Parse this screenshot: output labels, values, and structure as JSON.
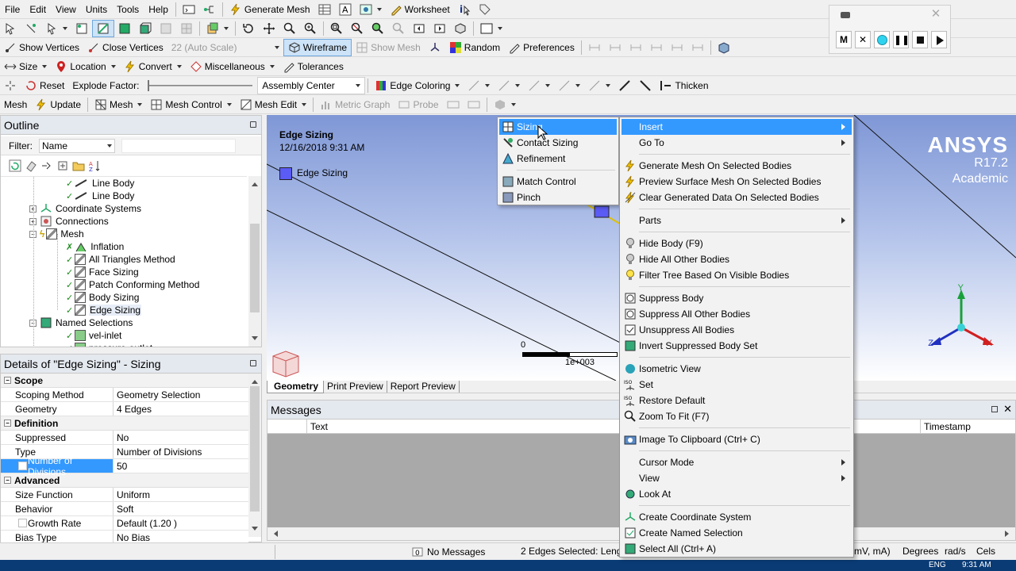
{
  "menubar": {
    "items": [
      "File",
      "Edit",
      "View",
      "Units",
      "Tools",
      "Help"
    ],
    "generate_mesh": "Generate Mesh",
    "worksheet": "Worksheet"
  },
  "toolbar2": {},
  "toolbar3": {
    "show_vertices": "Show Vertices",
    "close_vertices": "Close Vertices",
    "auto_scale": "22 (Auto Scale)",
    "wireframe": "Wireframe",
    "show_mesh": "Show Mesh",
    "random": "Random",
    "preferences": "Preferences"
  },
  "toolbar4": {
    "size": "Size",
    "location": "Location",
    "convert": "Convert",
    "miscellaneous": "Miscellaneous",
    "tolerances": "Tolerances"
  },
  "toolbar5": {
    "reset": "Reset",
    "explode_factor": "Explode Factor:",
    "assembly_center": "Assembly Center",
    "edge_coloring": "Edge Coloring",
    "thicken": "Thicken"
  },
  "toolbar6": {
    "mesh": "Mesh",
    "update": "Update",
    "mesh_dd": "Mesh",
    "mesh_control": "Mesh Control",
    "mesh_edit": "Mesh Edit",
    "metric_graph": "Metric Graph",
    "probe": "Probe"
  },
  "outline": {
    "title": "Outline",
    "filter_label": "Filter:",
    "filter_value": "Name",
    "items": [
      {
        "label": "Line Body"
      },
      {
        "label": "Line Body"
      },
      {
        "label": "Coordinate Systems"
      },
      {
        "label": "Connections"
      },
      {
        "label": "Mesh"
      },
      {
        "label": "Inflation"
      },
      {
        "label": "All Triangles Method"
      },
      {
        "label": "Face Sizing"
      },
      {
        "label": "Patch Conforming Method"
      },
      {
        "label": "Body Sizing"
      },
      {
        "label": "Edge Sizing"
      },
      {
        "label": "Named Selections"
      },
      {
        "label": "vel-inlet"
      },
      {
        "label": "pressure-outlet"
      }
    ]
  },
  "details": {
    "title": "Details of \"Edge Sizing\" - Sizing",
    "sections": {
      "scope": "Scope",
      "definition": "Definition",
      "advanced": "Advanced"
    },
    "rows": {
      "scoping_method": {
        "k": "Scoping Method",
        "v": "Geometry Selection"
      },
      "geometry": {
        "k": "Geometry",
        "v": "4 Edges"
      },
      "suppressed": {
        "k": "Suppressed",
        "v": "No"
      },
      "type": {
        "k": "Type",
        "v": "Number of Divisions"
      },
      "num_div": {
        "k": "Number of Divisions",
        "v": "50"
      },
      "size_function": {
        "k": "Size Function",
        "v": "Uniform"
      },
      "behavior": {
        "k": "Behavior",
        "v": "Soft"
      },
      "growth_rate": {
        "k": "Growth Rate",
        "v": "Default (1.20 )"
      },
      "bias_type": {
        "k": "Bias Type",
        "v": "No Bias"
      }
    }
  },
  "viewport": {
    "title": "Edge Sizing",
    "date": "12/16/2018 9:31 AM",
    "legend": "Edge Sizing",
    "brand": "ANSYS",
    "version": "R17.2",
    "edition": "Academic",
    "scale_zero": "0",
    "scale_max": "1e+003",
    "axis_y": "Y",
    "axis_x": "X",
    "axis_z": "Z",
    "tabs": [
      "Geometry",
      "Print Preview",
      "Report Preview"
    ]
  },
  "messages": {
    "title": "Messages",
    "col_text": "Text",
    "col_timestamp": "Timestamp"
  },
  "statusbar": {
    "no_messages": "No Messages",
    "selection": "2 Edges Selected: Lengt",
    "units": "mV, mA)",
    "degrees": "Degrees",
    "rads": "rad/s",
    "cels": "Cels"
  },
  "media": {
    "m": "M"
  },
  "taskbar": {
    "lang": "ENG",
    "time": "9:31 AM"
  },
  "submenu": {
    "items": [
      "Sizing",
      "Contact Sizing",
      "Refinement",
      "Match Control",
      "Pinch"
    ]
  },
  "context": {
    "items": [
      "Insert",
      "Go To",
      "Generate Mesh On Selected Bodies",
      "Preview Surface Mesh On Selected Bodies",
      "Clear Generated Data On Selected Bodies",
      "Parts",
      "Hide Body (F9)",
      "Hide All Other Bodies",
      "Filter Tree Based On Visible Bodies",
      "Suppress Body",
      "Suppress All Other Bodies",
      "Unsuppress All Bodies",
      "Invert Suppressed Body Set",
      "Isometric View",
      "Set",
      "Restore Default",
      "Zoom To Fit (F7)",
      "Image To Clipboard (Ctrl+ C)",
      "Cursor Mode",
      "View",
      "Look At",
      "Create Coordinate System",
      "Create Named Selection",
      "Select All (Ctrl+ A)"
    ]
  },
  "colors": {
    "highlight": "#3399ff",
    "viewport_top": "#7f97d6",
    "viewport_bottom": "#ffffff",
    "edge_sizing": "#5b5bf5"
  }
}
